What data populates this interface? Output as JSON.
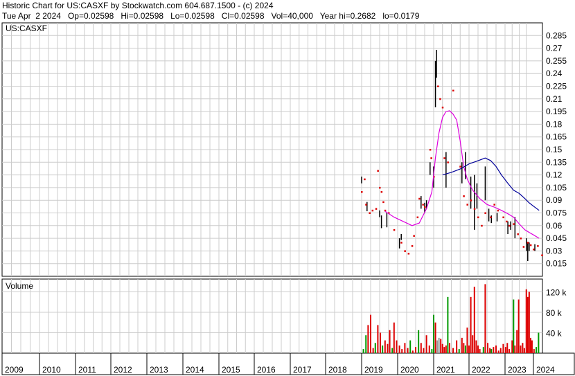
{
  "header": {
    "line1": "Historic Chart for US:CASXF by Stockwatch.com 604.687.1500 - (c) 2024",
    "line2": "Tue Apr  2 2024   Op=0.02598   Hi=0.02598   Lo=0.02598   Cl=0.02598   Vol=40,000   Year hi=0.2682   lo=0.0179"
  },
  "chart_data": [
    {
      "type": "candlestick",
      "title": "US:CASXF",
      "ylim": [
        0.0,
        0.3
      ],
      "xlim": [
        2009.0,
        2024.35
      ],
      "y_ticks": [
        "0.285",
        "0.27",
        "0.255",
        "0.24",
        "0.225",
        "0.21",
        "0.195",
        "0.18",
        "0.165",
        "0.15",
        "0.135",
        "0.12",
        "0.105",
        "0.09",
        "0.075",
        "0.06",
        "0.045",
        "0.03",
        "0.015"
      ],
      "x_ticks": [
        "2009",
        "2010",
        "2011",
        "2012",
        "2013",
        "2014",
        "2015",
        "2016",
        "2017",
        "2018",
        "2019",
        "2020",
        "2021",
        "2022",
        "2023",
        "2024"
      ],
      "grid": true,
      "colors": {
        "bar": "#000000",
        "close_tick": "#dd0000",
        "ma_short": "#dd00dd",
        "ma_long": "#000099",
        "grid": "#cccccc"
      },
      "price_bars": [
        {
          "t": 2019.0,
          "lo": 0.11,
          "hi": 0.118
        },
        {
          "t": 2019.15,
          "lo": 0.077,
          "hi": 0.088
        },
        {
          "t": 2019.5,
          "lo": 0.07,
          "hi": 0.078
        },
        {
          "t": 2019.55,
          "lo": 0.057,
          "hi": 0.072
        },
        {
          "t": 2019.7,
          "lo": 0.058,
          "hi": 0.075
        },
        {
          "t": 2020.05,
          "lo": 0.033,
          "hi": 0.045
        },
        {
          "t": 2020.1,
          "lo": 0.043,
          "hi": 0.05
        },
        {
          "t": 2020.65,
          "lo": 0.08,
          "hi": 0.095
        },
        {
          "t": 2020.75,
          "lo": 0.075,
          "hi": 0.087
        },
        {
          "t": 2020.8,
          "lo": 0.08,
          "hi": 0.09
        },
        {
          "t": 2020.9,
          "lo": 0.12,
          "hi": 0.135
        },
        {
          "t": 2021.0,
          "lo": 0.105,
          "hi": 0.13
        },
        {
          "t": 2021.05,
          "lo": 0.2,
          "hi": 0.255
        },
        {
          "t": 2021.08,
          "lo": 0.235,
          "hi": 0.268
        },
        {
          "t": 2021.35,
          "lo": 0.105,
          "hi": 0.147
        },
        {
          "t": 2021.8,
          "lo": 0.11,
          "hi": 0.135
        },
        {
          "t": 2021.9,
          "lo": 0.115,
          "hi": 0.147
        },
        {
          "t": 2022.05,
          "lo": 0.08,
          "hi": 0.118
        },
        {
          "t": 2022.15,
          "lo": 0.055,
          "hi": 0.12
        },
        {
          "t": 2022.22,
          "lo": 0.08,
          "hi": 0.11
        },
        {
          "t": 2022.45,
          "lo": 0.09,
          "hi": 0.13
        },
        {
          "t": 2022.55,
          "lo": 0.065,
          "hi": 0.08
        },
        {
          "t": 2022.62,
          "lo": 0.063,
          "hi": 0.072
        },
        {
          "t": 2022.78,
          "lo": 0.065,
          "hi": 0.075
        },
        {
          "t": 2023.1,
          "lo": 0.05,
          "hi": 0.065
        },
        {
          "t": 2023.2,
          "lo": 0.055,
          "hi": 0.065
        },
        {
          "t": 2023.35,
          "lo": 0.045,
          "hi": 0.07
        },
        {
          "t": 2023.75,
          "lo": 0.03,
          "hi": 0.045
        },
        {
          "t": 2023.8,
          "lo": 0.018,
          "hi": 0.04
        },
        {
          "t": 2023.85,
          "lo": 0.03,
          "hi": 0.04
        },
        {
          "t": 2024.05,
          "lo": 0.03,
          "hi": 0.038
        }
      ],
      "close_ticks": [
        {
          "t": 2019.0,
          "v": 0.1
        },
        {
          "t": 2019.08,
          "v": 0.115
        },
        {
          "t": 2019.12,
          "v": 0.085
        },
        {
          "t": 2019.22,
          "v": 0.075
        },
        {
          "t": 2019.3,
          "v": 0.078
        },
        {
          "t": 2019.4,
          "v": 0.08
        },
        {
          "t": 2019.45,
          "v": 0.125
        },
        {
          "t": 2019.5,
          "v": 0.105
        },
        {
          "t": 2019.55,
          "v": 0.1
        },
        {
          "t": 2019.6,
          "v": 0.088
        },
        {
          "t": 2019.65,
          "v": 0.078
        },
        {
          "t": 2019.75,
          "v": 0.075
        },
        {
          "t": 2019.9,
          "v": 0.055
        },
        {
          "t": 2020.1,
          "v": 0.04
        },
        {
          "t": 2020.2,
          "v": 0.03
        },
        {
          "t": 2020.3,
          "v": 0.027
        },
        {
          "t": 2020.4,
          "v": 0.036
        },
        {
          "t": 2020.45,
          "v": 0.048
        },
        {
          "t": 2020.55,
          "v": 0.07
        },
        {
          "t": 2020.6,
          "v": 0.092
        },
        {
          "t": 2020.7,
          "v": 0.085
        },
        {
          "t": 2020.75,
          "v": 0.082
        },
        {
          "t": 2020.9,
          "v": 0.15
        },
        {
          "t": 2020.93,
          "v": 0.14
        },
        {
          "t": 2021.0,
          "v": 0.118
        },
        {
          "t": 2021.12,
          "v": 0.225
        },
        {
          "t": 2021.18,
          "v": 0.21
        },
        {
          "t": 2021.25,
          "v": 0.2
        },
        {
          "t": 2021.3,
          "v": 0.14
        },
        {
          "t": 2021.4,
          "v": 0.135
        },
        {
          "t": 2021.55,
          "v": 0.22
        },
        {
          "t": 2021.75,
          "v": 0.13
        },
        {
          "t": 2021.85,
          "v": 0.095
        },
        {
          "t": 2021.95,
          "v": 0.085
        },
        {
          "t": 2022.05,
          "v": 0.09
        },
        {
          "t": 2022.15,
          "v": 0.08
        },
        {
          "t": 2022.25,
          "v": 0.07
        },
        {
          "t": 2022.35,
          "v": 0.06
        },
        {
          "t": 2022.45,
          "v": 0.075
        },
        {
          "t": 2022.6,
          "v": 0.07
        },
        {
          "t": 2022.7,
          "v": 0.085
        },
        {
          "t": 2022.8,
          "v": 0.078
        },
        {
          "t": 2022.95,
          "v": 0.07
        },
        {
          "t": 2023.05,
          "v": 0.065
        },
        {
          "t": 2023.15,
          "v": 0.06
        },
        {
          "t": 2023.3,
          "v": 0.062
        },
        {
          "t": 2023.45,
          "v": 0.05
        },
        {
          "t": 2023.55,
          "v": 0.045
        },
        {
          "t": 2023.65,
          "v": 0.035
        },
        {
          "t": 2023.8,
          "v": 0.04
        },
        {
          "t": 2023.9,
          "v": 0.037
        },
        {
          "t": 2024.0,
          "v": 0.032
        },
        {
          "t": 2024.15,
          "v": 0.036
        },
        {
          "t": 2024.3,
          "v": 0.025
        }
      ],
      "ma_short": [
        {
          "t": 2019.65,
          "v": 0.077
        },
        {
          "t": 2019.9,
          "v": 0.07
        },
        {
          "t": 2020.15,
          "v": 0.065
        },
        {
          "t": 2020.4,
          "v": 0.06
        },
        {
          "t": 2020.6,
          "v": 0.063
        },
        {
          "t": 2020.8,
          "v": 0.08
        },
        {
          "t": 2020.95,
          "v": 0.1
        },
        {
          "t": 2021.05,
          "v": 0.14
        },
        {
          "t": 2021.15,
          "v": 0.17
        },
        {
          "t": 2021.25,
          "v": 0.188
        },
        {
          "t": 2021.35,
          "v": 0.195
        },
        {
          "t": 2021.45,
          "v": 0.196
        },
        {
          "t": 2021.55,
          "v": 0.192
        },
        {
          "t": 2021.65,
          "v": 0.185
        },
        {
          "t": 2021.75,
          "v": 0.16
        },
        {
          "t": 2021.85,
          "v": 0.13
        },
        {
          "t": 2021.95,
          "v": 0.115
        },
        {
          "t": 2022.1,
          "v": 0.102
        },
        {
          "t": 2022.3,
          "v": 0.092
        },
        {
          "t": 2022.5,
          "v": 0.085
        },
        {
          "t": 2022.7,
          "v": 0.082
        },
        {
          "t": 2022.9,
          "v": 0.078
        },
        {
          "t": 2023.1,
          "v": 0.074
        },
        {
          "t": 2023.3,
          "v": 0.07
        },
        {
          "t": 2023.5,
          "v": 0.062
        },
        {
          "t": 2023.7,
          "v": 0.055
        },
        {
          "t": 2023.85,
          "v": 0.052
        },
        {
          "t": 2024.0,
          "v": 0.049
        },
        {
          "t": 2024.2,
          "v": 0.045
        }
      ],
      "ma_long": [
        {
          "t": 2021.25,
          "v": 0.12
        },
        {
          "t": 2021.5,
          "v": 0.123
        },
        {
          "t": 2021.75,
          "v": 0.127
        },
        {
          "t": 2022.0,
          "v": 0.133
        },
        {
          "t": 2022.2,
          "v": 0.136
        },
        {
          "t": 2022.45,
          "v": 0.14
        },
        {
          "t": 2022.6,
          "v": 0.137
        },
        {
          "t": 2022.75,
          "v": 0.13
        },
        {
          "t": 2022.9,
          "v": 0.12
        },
        {
          "t": 2023.1,
          "v": 0.11
        },
        {
          "t": 2023.3,
          "v": 0.102
        },
        {
          "t": 2023.5,
          "v": 0.098
        },
        {
          "t": 2023.7,
          "v": 0.092
        },
        {
          "t": 2023.85,
          "v": 0.087
        },
        {
          "t": 2024.0,
          "v": 0.083
        },
        {
          "t": 2024.2,
          "v": 0.078
        }
      ]
    },
    {
      "type": "bar",
      "title": "Volume",
      "ylim": [
        0,
        145000
      ],
      "y_ticks": [
        "120 k",
        "80 k",
        "40 k"
      ],
      "colors": {
        "up": "#009900",
        "down": "#dd0000",
        "flat": "#999999"
      },
      "bars": [
        {
          "t": 2019.05,
          "v": 8000,
          "c": "up"
        },
        {
          "t": 2019.12,
          "v": 35000,
          "c": "up"
        },
        {
          "t": 2019.18,
          "v": 55000,
          "c": "down"
        },
        {
          "t": 2019.25,
          "v": 75000,
          "c": "down"
        },
        {
          "t": 2019.32,
          "v": 10000,
          "c": "down"
        },
        {
          "t": 2019.38,
          "v": 20000,
          "c": "up"
        },
        {
          "t": 2019.45,
          "v": 55000,
          "c": "down"
        },
        {
          "t": 2019.52,
          "v": 40000,
          "c": "down"
        },
        {
          "t": 2019.58,
          "v": 15000,
          "c": "up"
        },
        {
          "t": 2019.65,
          "v": 25000,
          "c": "down"
        },
        {
          "t": 2019.72,
          "v": 18000,
          "c": "down"
        },
        {
          "t": 2019.78,
          "v": 45000,
          "c": "down"
        },
        {
          "t": 2019.85,
          "v": 10000,
          "c": "up"
        },
        {
          "t": 2019.9,
          "v": 60000,
          "c": "down"
        },
        {
          "t": 2019.97,
          "v": 25000,
          "c": "down"
        },
        {
          "t": 2020.05,
          "v": 15000,
          "c": "down"
        },
        {
          "t": 2020.12,
          "v": 8000,
          "c": "down"
        },
        {
          "t": 2020.2,
          "v": 20000,
          "c": "down"
        },
        {
          "t": 2020.28,
          "v": 10000,
          "c": "down"
        },
        {
          "t": 2020.35,
          "v": 25000,
          "c": "up"
        },
        {
          "t": 2020.42,
          "v": 5000,
          "c": "down"
        },
        {
          "t": 2020.5,
          "v": 12000,
          "c": "down"
        },
        {
          "t": 2020.58,
          "v": 45000,
          "c": "up"
        },
        {
          "t": 2020.65,
          "v": 20000,
          "c": "down"
        },
        {
          "t": 2020.72,
          "v": 10000,
          "c": "down"
        },
        {
          "t": 2020.8,
          "v": 35000,
          "c": "down"
        },
        {
          "t": 2020.88,
          "v": 15000,
          "c": "down"
        },
        {
          "t": 2020.95,
          "v": 8000,
          "c": "up"
        },
        {
          "t": 2021.0,
          "v": 75000,
          "c": "up"
        },
        {
          "t": 2021.05,
          "v": 60000,
          "c": "down"
        },
        {
          "t": 2021.1,
          "v": 25000,
          "c": "flat"
        },
        {
          "t": 2021.15,
          "v": 30000,
          "c": "flat"
        },
        {
          "t": 2021.2,
          "v": 28000,
          "c": "down"
        },
        {
          "t": 2021.25,
          "v": 18000,
          "c": "down"
        },
        {
          "t": 2021.3,
          "v": 12000,
          "c": "down"
        },
        {
          "t": 2021.35,
          "v": 15000,
          "c": "down"
        },
        {
          "t": 2021.4,
          "v": 110000,
          "c": "up"
        },
        {
          "t": 2021.45,
          "v": 20000,
          "c": "down"
        },
        {
          "t": 2021.55,
          "v": 10000,
          "c": "down"
        },
        {
          "t": 2021.65,
          "v": 25000,
          "c": "down"
        },
        {
          "t": 2021.72,
          "v": 8000,
          "c": "up"
        },
        {
          "t": 2021.8,
          "v": 30000,
          "c": "down"
        },
        {
          "t": 2021.85,
          "v": 20000,
          "c": "down"
        },
        {
          "t": 2021.9,
          "v": 15000,
          "c": "up"
        },
        {
          "t": 2021.95,
          "v": 50000,
          "c": "down"
        },
        {
          "t": 2022.0,
          "v": 15000,
          "c": "down"
        },
        {
          "t": 2022.05,
          "v": 110000,
          "c": "down"
        },
        {
          "t": 2022.1,
          "v": 35000,
          "c": "down"
        },
        {
          "t": 2022.15,
          "v": 130000,
          "c": "down"
        },
        {
          "t": 2022.2,
          "v": 25000,
          "c": "down"
        },
        {
          "t": 2022.25,
          "v": 15000,
          "c": "down"
        },
        {
          "t": 2022.3,
          "v": 8000,
          "c": "down"
        },
        {
          "t": 2022.4,
          "v": 12000,
          "c": "up"
        },
        {
          "t": 2022.45,
          "v": 135000,
          "c": "down"
        },
        {
          "t": 2022.52,
          "v": 20000,
          "c": "down"
        },
        {
          "t": 2022.58,
          "v": 10000,
          "c": "down"
        },
        {
          "t": 2022.62,
          "v": 8000,
          "c": "up"
        },
        {
          "t": 2022.68,
          "v": 12000,
          "c": "down"
        },
        {
          "t": 2022.75,
          "v": 15000,
          "c": "down"
        },
        {
          "t": 2022.82,
          "v": 5000,
          "c": "down"
        },
        {
          "t": 2022.88,
          "v": 10000,
          "c": "down"
        },
        {
          "t": 2022.95,
          "v": 18000,
          "c": "down"
        },
        {
          "t": 2023.02,
          "v": 12000,
          "c": "down"
        },
        {
          "t": 2023.08,
          "v": 20000,
          "c": "down"
        },
        {
          "t": 2023.15,
          "v": 8000,
          "c": "down"
        },
        {
          "t": 2023.25,
          "v": 25000,
          "c": "down"
        },
        {
          "t": 2023.3,
          "v": 105000,
          "c": "up"
        },
        {
          "t": 2023.35,
          "v": 15000,
          "c": "down"
        },
        {
          "t": 2023.42,
          "v": 45000,
          "c": "down"
        },
        {
          "t": 2023.48,
          "v": 105000,
          "c": "down"
        },
        {
          "t": 2023.55,
          "v": 15000,
          "c": "down"
        },
        {
          "t": 2023.62,
          "v": 20000,
          "c": "down"
        },
        {
          "t": 2023.68,
          "v": 10000,
          "c": "down"
        },
        {
          "t": 2023.75,
          "v": 125000,
          "c": "down"
        },
        {
          "t": 2023.8,
          "v": 110000,
          "c": "down"
        },
        {
          "t": 2023.85,
          "v": 120000,
          "c": "down"
        },
        {
          "t": 2023.9,
          "v": 30000,
          "c": "down"
        },
        {
          "t": 2023.95,
          "v": 25000,
          "c": "down"
        },
        {
          "t": 2024.02,
          "v": 8000,
          "c": "down"
        },
        {
          "t": 2024.1,
          "v": 12000,
          "c": "up"
        },
        {
          "t": 2024.18,
          "v": 40000,
          "c": "up"
        }
      ]
    }
  ]
}
